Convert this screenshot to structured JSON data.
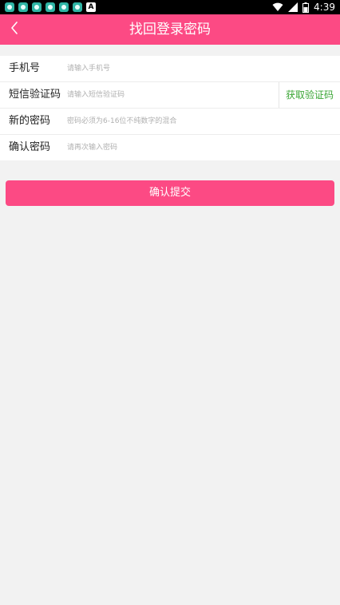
{
  "status_bar": {
    "time": "4:39",
    "notification_icons": [
      "app-icon",
      "app-icon",
      "app-icon",
      "app-icon",
      "app-icon",
      "app-icon",
      "a-icon"
    ],
    "notification_a_label": "A",
    "system_icons": [
      "wifi-icon",
      "cell-signal-icon",
      "battery-icon"
    ]
  },
  "header": {
    "back_icon": "chevron-left-icon",
    "title": "找回登录密码"
  },
  "form": {
    "phone": {
      "label": "手机号",
      "placeholder": "请输入手机号",
      "value": ""
    },
    "sms_code": {
      "label": "短信验证码",
      "placeholder": "请输入短信验证码",
      "value": "",
      "get_code_label": "获取验证码"
    },
    "new_password": {
      "label": "新的密码",
      "placeholder": "密码必须为6-16位不纯数字的混合",
      "value": ""
    },
    "confirm_password": {
      "label": "确认密码",
      "placeholder": "请再次输入密码",
      "value": ""
    }
  },
  "submit_label": "确认提交",
  "colors": {
    "brand": "#fc4a84",
    "get_code": "#3aa534",
    "background": "#f2f2f2",
    "status_bar": "#000000"
  }
}
